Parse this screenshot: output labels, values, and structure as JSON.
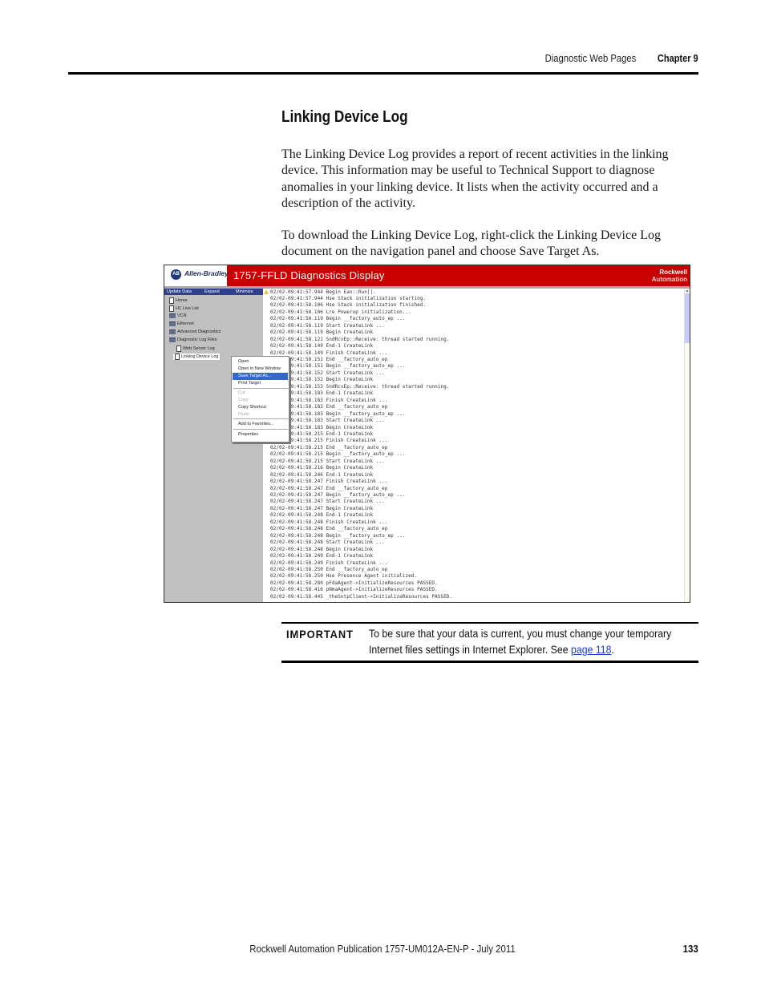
{
  "header": {
    "section": "Diagnostic Web Pages",
    "chapter": "Chapter 9"
  },
  "section_title": "Linking Device Log",
  "paragraphs": [
    "The Linking Device Log provides a report of recent activities in the linking device. This information may be useful to Technical Support to diagnose anomalies in your linking device. It lists when the activity occurred and a description of the activity.",
    "To download the Linking Device Log, right-click the Linking Device Log document on the navigation panel and choose Save Target As."
  ],
  "screenshot": {
    "brand_left": "Allen-Bradley",
    "brand_left_badge": "AB",
    "title": "1757-FFLD Diagnostics Display",
    "brand_right_line1": "Rockwell",
    "brand_right_line2": "Automation",
    "nav_toolbar": [
      "Update Data",
      "Expand",
      "Minimize"
    ],
    "nav_items": [
      {
        "label": "Home",
        "icon": "document-icon"
      },
      {
        "label": "H1 Live List",
        "icon": "document-icon"
      },
      {
        "label": "VCR",
        "icon": "folder-icon"
      },
      {
        "label": "Ethernet",
        "icon": "folder-icon"
      },
      {
        "label": "Advanced Diagnostics",
        "icon": "folder-icon"
      },
      {
        "label": "Diagnostic Log Files",
        "icon": "open-folder-icon"
      },
      {
        "label": "Web Server Log",
        "icon": "document-icon"
      },
      {
        "label": "Linking Device Log",
        "icon": "document-icon"
      }
    ],
    "context_menu": [
      {
        "label": "Open",
        "state": "normal"
      },
      {
        "label": "Open in New Window",
        "state": "normal"
      },
      {
        "label": "Save Target As...",
        "state": "active"
      },
      {
        "label": "Print Target",
        "state": "normal"
      },
      {
        "label": "Cut",
        "state": "disabled"
      },
      {
        "label": "Copy",
        "state": "disabled"
      },
      {
        "label": "Copy Shortcut",
        "state": "normal"
      },
      {
        "label": "Paste",
        "state": "disabled"
      },
      {
        "label": "Add to Favorites...",
        "state": "normal"
      },
      {
        "label": "Properties",
        "state": "normal"
      }
    ],
    "log_lines": [
      "02/02-09:41:57.944 Begin Ean::Run||.",
      "02/02-09:41:57.944 Hse Stack initialization starting.",
      "02/02-09:41:58.106 Hse Stack initialization finished.",
      "02/02-09:41:58.106 Lre Powerup initialization...",
      "02/02-09:41:58.119 Begin __factory_auto_ep ...",
      "02/02-09:41:58.119 Start CreateLink ...",
      "02/02-09:41:58.119 Begin CreateLink",
      "02/02-09:41:58.121 SndRcvEp::Receive: thread started running.",
      "02/02-09:41:58.149 End-1 CreateLink",
      "02/02-09:41:58.149 Finish CreateLink ...",
      "02/02-09:41:58.151 End __factory_auto_ep",
      "02/02-09:41:58.151 Begin __factory_auto_ep ...",
      "02/02-09:41:58.152 Start CreateLink ...",
      "02/02-09:41:58.152 Begin CreateLink",
      "02/02-09:41:58.153 SndRcvEp::Receive: thread started running.",
      "02/02-09:41:58.183 End-1 CreateLink",
      "02/02-09:41:58.183 Finish CreateLink ...",
      "02/02-09:41:58.183 End __factory_auto_ep",
      "02/02-09:41:58.183 Begin __factory_auto_ep ...",
      "02/02-09:41:58.183 Start CreateLink ...",
      "02/02-09:41:58.183 Begin CreateLink",
      "02/02-09:41:58.215 End-1 CreateLink",
      "02/02-09:41:58.215 Finish CreateLink ...",
      "02/02-09:41:58.215 End __factory_auto_ep",
      "02/02-09:41:58.215 Begin __factory_auto_ep ...",
      "02/02-09:41:58.215 Start CreateLink ...",
      "02/02-09:41:58.216 Begin CreateLink",
      "02/02-09:41:58.246 End-1 CreateLink",
      "02/02-09:41:58.247 Finish CreateLink ...",
      "02/02-09:41:58.247 End __factory_auto_ep",
      "02/02-09:41:58.247 Begin __factory_auto_ep ...",
      "02/02-09:41:58.247 Start CreateLink ...",
      "02/02-09:41:58.247 Begin CreateLink",
      "02/02-09:41:58.248 End-1 CreateLink",
      "02/02-09:41:58.248 Finish CreateLink ...",
      "02/02-09:41:58.248 End __factory_auto_ep",
      "02/02-09:41:58.248 Begin __factory_auto_ep ...",
      "02/02-09:41:58.248 Start CreateLink ...",
      "02/02-09:41:58.248 Begin CreateLink",
      "02/02-09:41:58.249 End-1 CreateLink",
      "02/02-09:41:58.249 Finish CreateLink ...",
      "02/02-09:41:58.250 End __factory_auto_ep",
      "02/02-09:41:58.250 Hse Presence Agent initialized.",
      "02/02-09:41:58.280 pFdaAgent->InitializeResources PASSED.",
      "02/02-09:41:58.416 pNmaAgent->InitializeResources PASSED.",
      "02/02-09:41:58.445 _theSntpClient->InitializeResources PASSED."
    ]
  },
  "important": {
    "label": "IMPORTANT",
    "text_before": "To be sure that your data is current, you must change your temporary",
    "text_line2": "Internet files settings in Internet Explorer. See ",
    "link": "page 118",
    "text_after": "."
  },
  "footer": {
    "publication": "Rockwell Automation Publication 1757-UM012A-EN-P - July 2011",
    "page_number": "133"
  }
}
